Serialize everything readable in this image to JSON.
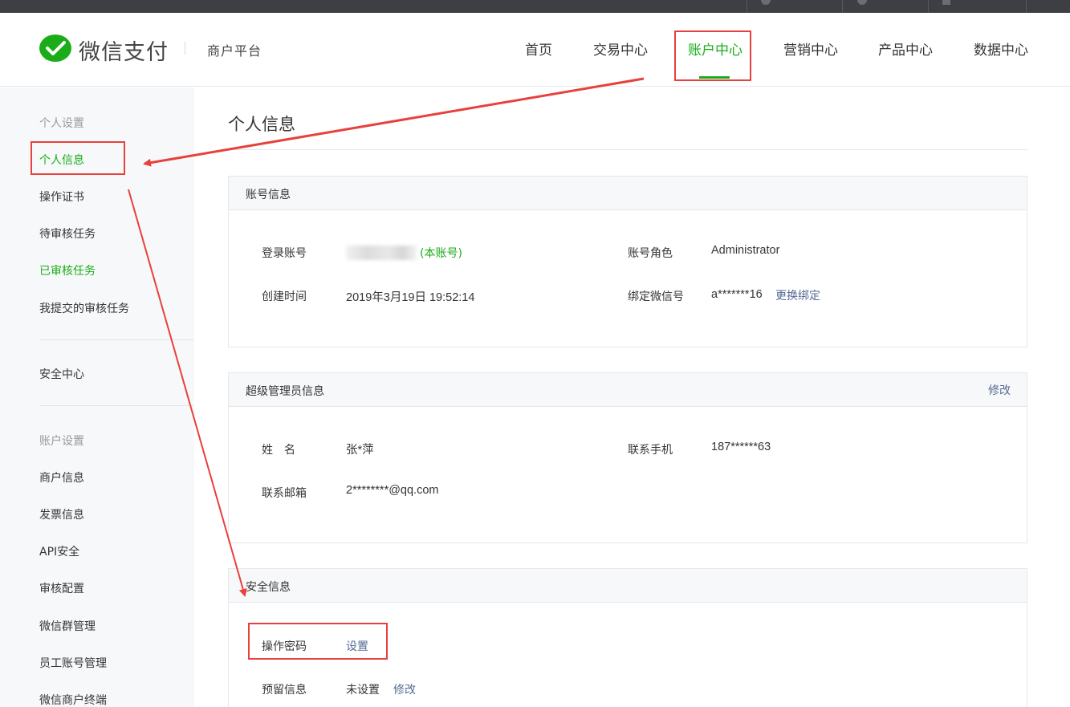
{
  "header": {
    "brand": "微信支付",
    "platform": "商户平台",
    "nav": [
      "首页",
      "交易中心",
      "账户中心",
      "营销中心",
      "产品中心",
      "数据中心"
    ],
    "active_nav": "账户中心"
  },
  "sidebar": {
    "group_personal": "个人设置",
    "items_personal": [
      "个人信息",
      "操作证书",
      "待审核任务",
      "已审核任务",
      "我提交的审核任务"
    ],
    "security_center": "安全中心",
    "group_account": "账户设置",
    "items_account": [
      "商户信息",
      "发票信息",
      "API安全",
      "审核配置",
      "微信群管理",
      "员工账号管理",
      "微信商户终端"
    ]
  },
  "page": {
    "title": "个人信息"
  },
  "account_info": {
    "title": "账号信息",
    "login_label": "登录账号",
    "login_tag": "(本账号)",
    "role_label": "账号角色",
    "role_value": "Administrator",
    "created_label": "创建时间",
    "created_value": "2019年3月19日 19:52:14",
    "wechat_label": "绑定微信号",
    "wechat_value": "a*******16",
    "wechat_action": "更换绑定"
  },
  "admin_info": {
    "title": "超级管理员信息",
    "edit": "修改",
    "name_label": "姓　名",
    "name_value": "张*萍",
    "phone_label": "联系手机",
    "phone_value": "187******63",
    "email_label": "联系邮箱",
    "email_value": "2********@qq.com"
  },
  "security_info": {
    "title": "安全信息",
    "password_label": "操作密码",
    "password_action": "设置",
    "reserved_label": "预留信息",
    "reserved_value": "未设置",
    "reserved_action": "修改"
  },
  "colors": {
    "accent_green": "#1aad19",
    "link_blue": "#576b95",
    "annotation_red": "#e8403c"
  }
}
